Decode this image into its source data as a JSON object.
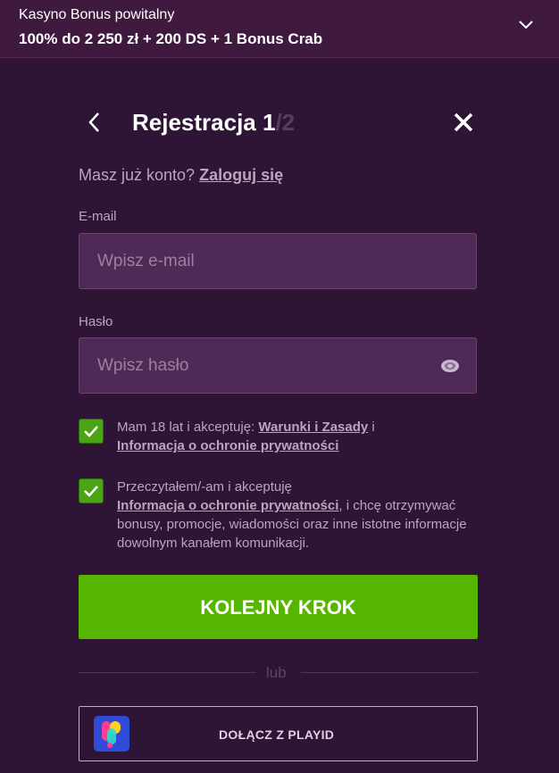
{
  "banner": {
    "line1": "Kasyno Bonus powitalny",
    "line2": "100% do 2 250 zł + 200 DS + 1 Bonus Crab"
  },
  "header": {
    "title": "Rejestracja 1",
    "step_total": "/2"
  },
  "login": {
    "prompt": "Masz już konto?",
    "link": "Zaloguj się"
  },
  "email": {
    "label": "E-mail",
    "placeholder": "Wpisz e-mail",
    "value": ""
  },
  "password": {
    "label": "Hasło",
    "placeholder": "Wpisz hasło",
    "value": ""
  },
  "consent1": {
    "checked": true,
    "text_a": "Mam 18 lat i akceptuję: ",
    "link1": "Warunki i Zasady",
    "text_b": " i",
    "link2": "Informacja o ochronie prywatności"
  },
  "consent2": {
    "checked": true,
    "text_a": "Przeczytałem/-am i akceptuję",
    "link": "Informacja o ochronie prywatności",
    "text_b": ", i chcę otrzymywać bonusy, promocje, wiadomości oraz inne istotne informacje dowolnym kanałem komunikacji."
  },
  "next_button": "KOLEJNY KROK",
  "divider_text": "lub",
  "playid_button": "DOŁĄCZ Z PLAYID",
  "colors": {
    "background": "#2e1535",
    "banner": "#40193f",
    "input_bg": "#4f2a56",
    "accent_green": "#55b500",
    "checkbox_green": "#4ba416"
  },
  "icons": [
    "chevron-down-icon",
    "back-arrow-icon",
    "close-icon",
    "eye-icon",
    "check-icon",
    "playid-logo-icon"
  ]
}
